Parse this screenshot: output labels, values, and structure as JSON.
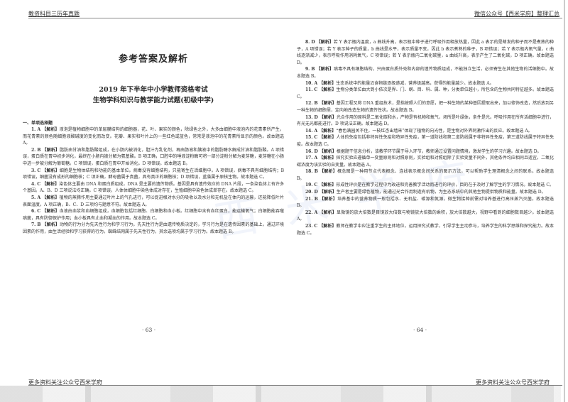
{
  "header": {
    "left": "教资科目三历年真题",
    "right": "微信公众号【西米学府】整理汇总"
  },
  "footer": {
    "left": "更多资料关注公众号西米学府",
    "right": "更多资料关注公众号西米学府"
  },
  "watermark": "西米学府",
  "left_page": {
    "title": "参考答案及解析",
    "subtitle1": "2019 年下半年中小学教师资格考试",
    "subtitle2": "生物学科知识与教学能力试题(初级中学)",
    "section": "一、单项选择题",
    "page_number": "· 63 ·",
    "paragraphs": [
      {
        "label": "1. A 【解析】",
        "text": "液泡是植物细胞中的单层膜结构的细胞器，花、叶、果实的颜色，除绿色之外，大多由细胞中液泡内的花青素所产生，而花青素的颜色随细胞液酸碱度的变化而改变。花瓣、果实和叶片上的一些红色或蓝色，常常是液泡中的花青素所显示的颜色。故本题选 A。"
      },
      {
        "label": "2. B 【解析】",
        "text": "脂肪由甘油和脂肪酸组成，在小肠内被消化，胆汁为乳化剂，再由肠液和胰液中的脂肪酶水解成甘油和脂肪酸。A 项错误，蛋白质在胃中初步消化，最终在小肠内被分解为氨基酸。B 项正确，口腔中的唾液淀粉酶可将一部分淀粉分解为麦芽糖，麦芽糖在小肠中进一步被分解为葡萄糖。C 项错误，蛋白质在胃中开始消化。D 项错误。故本题选 B。"
      },
      {
        "label": "3. C 【解析】",
        "text": "细胞是生物体结构和功能的基本单位。病毒没有细胞结构，只能寄生在活细胞中。A 项错误，病毒不具有细胞结构；B 项错误，细菌没有成形的细胞核；C 项正确，酵母菌属于真菌，具有真正的细胞核；D 项错误，蓝藻属于原核生物。故本题选 C。"
      },
      {
        "label": "4. C 【解析】",
        "text": "染色体主要由 DNA 和蛋白质组成，DNA 是主要的遗传物质。基因是具有遗传效应的 DNA 片段，一条染色体上有许多个基因。A、B、D 三项说法均正确。C 项错误，人体体细胞中染色体成对存在，生殖细胞中染色体成单存在。故本题选 C。"
      },
      {
        "label": "5. A 【解析】",
        "text": "植物的蒸腾作用主要通过叶片上的气孔进行，可以促进根对水分的吸收以及水分和无机盐在体内的运输，还能降低叶片表面温度。A 项正确，B、C、D 三项均与题意不符。故本题选 A。"
      },
      {
        "label": "6. C 【解析】",
        "text": "血液由血浆和血细胞组成，血细胞包括红细胞、白细胞和血小板。红细胞中含有血红蛋白，能运输氧气；白细胞能吞噬病菌，具有防御保护作用；血小板具有止血和凝血的作用。故本题选 C。"
      },
      {
        "label": "7. B 【解析】",
        "text": "动物的行为分为先天性行为和学习行为。先天性行为是由遗传物质决定的，学习行为是在遗传因素的基础上，通过环境因素的作用，由生活经验和学习获得的行为。蜘蛛结网属于先天性行为，其余选项均属于学习行为。故本题选 B。"
      }
    ]
  },
  "right_page": {
    "page_number": "· 64 ·",
    "paragraphs": [
      {
        "label": "8. D 【解析】",
        "text": "若 Y 表示瓶内温度，a 曲线升高，表示瓶中种子进行呼吸作用释放热量，因此 a 表示的是萌发的种子而不是煮熟的种子，A 项错误；若 Y 表示种子的质量，b 曲线是水平，表示质量不变，因此 b 表示煮熟的种子，B 项错误；若 Y 表示瓶内氧气量，c 曲线逐渐减少，表示呼吸作用消耗氧气，C 项错误；若 Y 表示瓶内二氧化碳量，a 曲线升高，表示产生了二氧化碳，D 项正确。故本题选 D。"
      },
      {
        "label": "9. B 【解析】",
        "text": "病毒不具有细胞结构，只由蛋白质外壳和内部的遗传物质组成，不能独立生活，必须寄生在其他生物的活细胞中。故本题选 B。"
      },
      {
        "label": "10. A 【解析】",
        "text": "生态系统中的能量沿食物链逐级递减，营养级越高，获得的能量越少。故本题选 A。"
      },
      {
        "label": "11. C 【解析】",
        "text": "生物分类单位由大到小依次是界、门、纲、目、科、属、种，分类单位越小，所包含的生物共同特征越多。故本题选 C。"
      },
      {
        "label": "12. B 【解析】",
        "text": "基因工程又称 DNA 重组技术，是指按照人们的意愿，把一种生物的某种基因提取出来，加以修饰改造，然后放到另一种生物的细胞里，定向地改造生物的遗传性状。故本题选 B。"
      },
      {
        "label": "13. D 【解析】",
        "text": "光合作用的原料是二氧化碳和水，产物是有机物和氧气，场所是叶绿体，条件是光。呼吸作用在所有活细胞中进行，有光无光都能进行。D 项说法正确。故本题选 D。"
      },
      {
        "label": "14. A 【解析】",
        "text": "“春色满园关不住，一枝红杏出墙来”体现了植物的向光性，是生物对外界刺激作出的反应。故本题选 A。"
      },
      {
        "label": "15. C 【解析】",
        "text": "人体的免疫包括非特异性免疫和特异性免疫，第一道防线和第二道防线属于非特异性免疫，第三道防线属于特异性免疫。故本题选 C。"
      },
      {
        "label": "16. D 【解析】",
        "text": "根据题干信息分析，该教学环节属于导入环节，教师通过设置问题情境，激发学生的学习兴趣。故本题选 D。"
      },
      {
        "label": "17. A 【解析】",
        "text": "探究实验应遵循单一变量原则和对照原则，实验组和对照组除了实验变量不同外，其他条件均应相同且适宜。二氧化碳浓度为该实验的自变量。故本题选 A。"
      },
      {
        "label": "18. B 【解析】",
        "text": "概念图是一种用节点代表概念、连线表示概念间关系的图示方法，可以帮助学生理清概念之间的联系。故本题选 B。"
      },
      {
        "label": "19. C 【解析】",
        "text": "形成性评价是在教学过程中为改进和完善教学活动而进行的评价，目的在于及时了解学生的学习情况。故本题选 C。"
      },
      {
        "label": "20. D 【解析】",
        "text": "生产者主要是绿色植物，能通过光合作用制造有机物，为生态系统中的其他生物提供物质和能量。故本题选 D。"
      },
      {
        "label": "21. B 【解析】",
        "text": "培养基中的营养物质一般包括水、无机盐、碳源和氮源，微生物接种前需对培养基进行高压蒸汽灭菌。故本题选 B。"
      },
      {
        "label": "22. A 【解析】",
        "text": "显微镜的放大倍数是目镜放大倍数与物镜放大倍数的乘积，放大倍数越大，视野中看到的细胞数目越少。故本题选 A。"
      },
      {
        "label": "23. C 【解析】",
        "text": "教师在教学中应注重学生的主体地位，运用探究式教学，引导学生主动参与，培养学生的科学思维和探究能力。故本题选 C。"
      }
    ]
  }
}
